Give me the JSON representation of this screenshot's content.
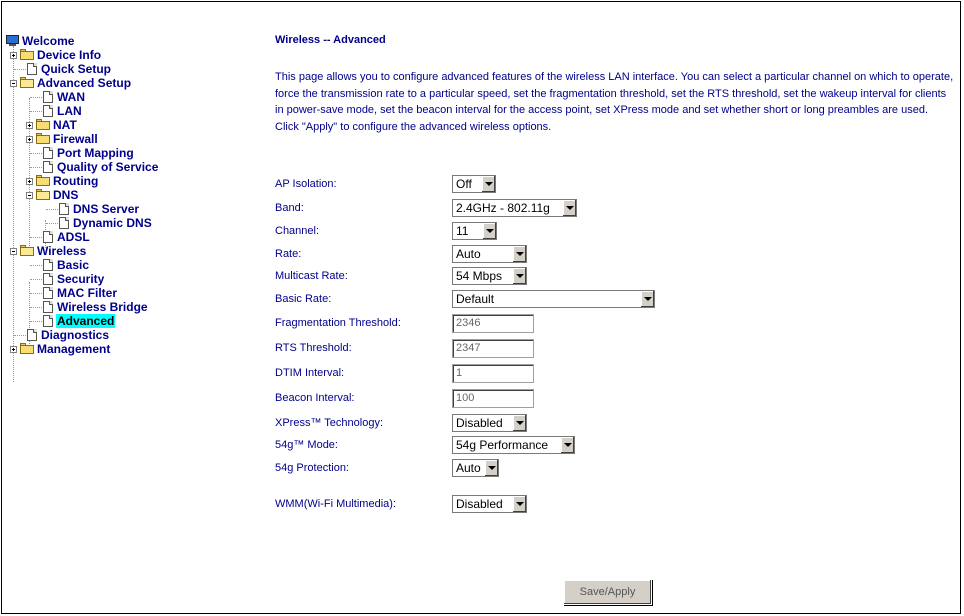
{
  "sidebar": {
    "items": [
      {
        "label": "Welcome"
      },
      {
        "label": "Device Info"
      },
      {
        "label": "Quick Setup"
      },
      {
        "label": "Advanced Setup"
      },
      {
        "label": "WAN"
      },
      {
        "label": "LAN"
      },
      {
        "label": "NAT"
      },
      {
        "label": "Firewall"
      },
      {
        "label": "Port Mapping"
      },
      {
        "label": "Quality of Service"
      },
      {
        "label": "Routing"
      },
      {
        "label": "DNS"
      },
      {
        "label": "DNS Server"
      },
      {
        "label": "Dynamic DNS"
      },
      {
        "label": "ADSL"
      },
      {
        "label": "Wireless"
      },
      {
        "label": "Basic"
      },
      {
        "label": "Security"
      },
      {
        "label": "MAC Filter"
      },
      {
        "label": "Wireless Bridge"
      },
      {
        "label": "Advanced"
      },
      {
        "label": "Diagnostics"
      },
      {
        "label": "Management"
      }
    ],
    "selected": "Advanced"
  },
  "main": {
    "title": "Wireless -- Advanced",
    "description": "This page allows you to configure advanced features of the wireless LAN interface. You can select a particular channel on which to operate, force the transmission rate to a particular speed, set the fragmentation threshold, set the RTS threshold, set the wakeup interval for clients in power-save mode, set the beacon interval for the access point, set XPress mode and set whether short or long preambles are used.",
    "instruction": "Click \"Apply\" to configure the advanced wireless options.",
    "fields": {
      "ap_isolation": {
        "label": "AP Isolation:",
        "value": "Off"
      },
      "band": {
        "label": "Band:",
        "value": "2.4GHz - 802.11g"
      },
      "channel": {
        "label": "Channel:",
        "value": "11"
      },
      "rate": {
        "label": "Rate:",
        "value": "Auto"
      },
      "multicast_rate": {
        "label": "Multicast Rate:",
        "value": "54 Mbps"
      },
      "basic_rate": {
        "label": "Basic Rate:",
        "value": "Default"
      },
      "fragmentation_threshold": {
        "label": "Fragmentation Threshold:",
        "value": "2346"
      },
      "rts_threshold": {
        "label": "RTS Threshold:",
        "value": "2347"
      },
      "dtim_interval": {
        "label": "DTIM Interval:",
        "value": "1"
      },
      "beacon_interval": {
        "label": "Beacon Interval:",
        "value": "100"
      },
      "xpress": {
        "label": "XPress™ Technology:",
        "value": "Disabled"
      },
      "mode_54g": {
        "label": "54g™ Mode:",
        "value": "54g Performance"
      },
      "protection_54g": {
        "label": "54g Protection:",
        "value": "Auto"
      },
      "wmm": {
        "label": "WMM(Wi-Fi Multimedia):",
        "value": "Disabled"
      }
    },
    "save_label": "Save/Apply"
  },
  "colors": {
    "link": "#00008b",
    "selected_bg": "#00ffff"
  }
}
